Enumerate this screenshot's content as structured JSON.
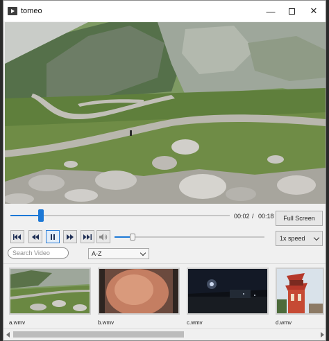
{
  "window": {
    "title": "tomeo"
  },
  "player": {
    "progress": 0.14,
    "current_time": "00:02",
    "separator": "/",
    "total_time": "00:18",
    "fullscreen_label": "Full Screen",
    "volume": 0.12,
    "speed": {
      "selected": "1x speed"
    },
    "accent": "#1c78d6"
  },
  "controls": {
    "first": "skip-to-start-icon",
    "back": "rewind-icon",
    "pause": "pause-icon",
    "forward": "fast-forward-icon",
    "last": "skip-to-end-icon",
    "volume": "speaker-icon"
  },
  "search": {
    "placeholder": "Search Video",
    "value": ""
  },
  "sort": {
    "selected": "A-Z"
  },
  "thumbnails": [
    {
      "label": "a.wmv"
    },
    {
      "label": "b.wmv"
    },
    {
      "label": "c.wmv"
    },
    {
      "label": "d.wmv"
    }
  ],
  "scrollbar": {
    "position": 0
  }
}
